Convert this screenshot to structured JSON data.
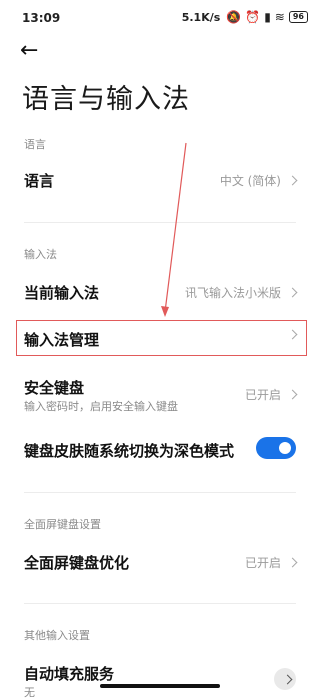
{
  "status": {
    "time": "13:09",
    "speed": "5.1K/s",
    "battery": "96"
  },
  "header": {
    "title": "语言与输入法"
  },
  "sections": {
    "language": {
      "label": "语言",
      "row": {
        "title": "语言",
        "value": "中文 (简体)"
      }
    },
    "input_method": {
      "label": "输入法",
      "current": {
        "title": "当前输入法",
        "value": "讯飞输入法小米版"
      },
      "manage": {
        "title": "输入法管理"
      },
      "secure": {
        "title": "安全键盘",
        "subtitle": "输入密码时，启用安全输入键盘",
        "value": "已开启"
      },
      "dark": {
        "title": "键盘皮肤随系统切换为深色模式",
        "toggle_on": true
      }
    },
    "fullscreen": {
      "label": "全面屏键盘设置",
      "row": {
        "title": "全面屏键盘优化",
        "value": "已开启"
      }
    },
    "other": {
      "label": "其他输入设置",
      "autofill": {
        "title": "自动填充服务",
        "value": "无"
      }
    }
  },
  "colors": {
    "accent": "#1a73e8",
    "annotation": "#e15a5a"
  },
  "icons": [
    "back-arrow-icon",
    "chevron-right-icon"
  ]
}
